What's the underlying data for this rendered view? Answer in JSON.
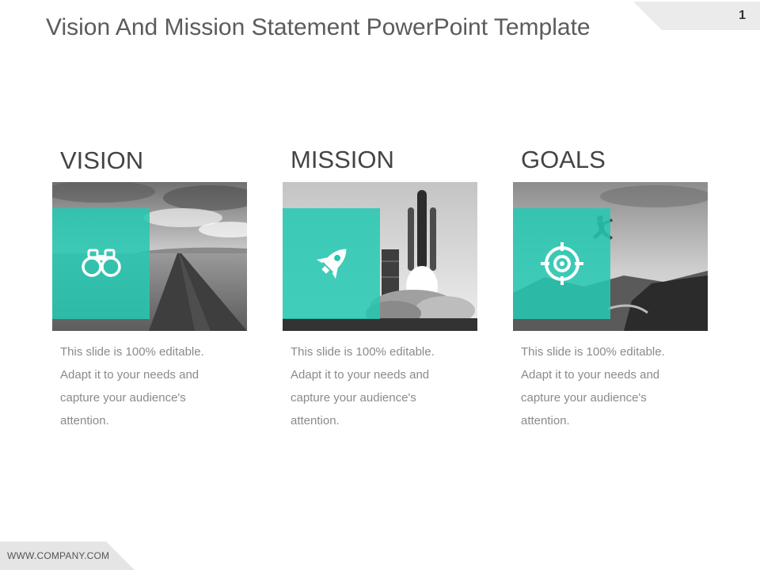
{
  "slide": {
    "title": "Vision And Mission Statement PowerPoint Template",
    "page_number": "1",
    "footer": "WWW.COMPANY.COM",
    "accent_color": "#24c9b2"
  },
  "columns": [
    {
      "heading": "VISION",
      "icon": "binoculars-icon",
      "photo": "country-road-photo",
      "body": "This slide is 100% editable. Adapt it to your needs and capture your audience's attention."
    },
    {
      "heading": "MISSION",
      "icon": "rocket-icon",
      "photo": "shuttle-launch-photo",
      "body": "This slide is 100% editable. Adapt it to your needs and capture your audience's attention."
    },
    {
      "heading": "GOALS",
      "icon": "target-icon",
      "photo": "cliff-jump-photo",
      "body": "This slide is 100% editable. Adapt it to your needs and capture your audience's attention."
    }
  ]
}
